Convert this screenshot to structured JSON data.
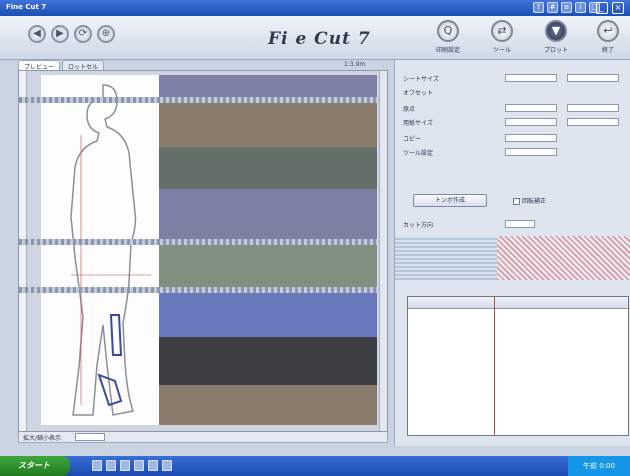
{
  "window": {
    "title": "Fine Cut 7",
    "logo_text": "Fi e Cut 7",
    "scale_text": "1:3.9m"
  },
  "toolbar": {
    "nav_buttons": [
      "◀",
      "▶",
      "⟳",
      "⊕"
    ],
    "buttons": [
      {
        "label": "印刷設定",
        "icon": "search-icon"
      },
      {
        "label": "ツール",
        "icon": "settings-icon"
      },
      {
        "label": "プロット",
        "icon": "plotter-icon"
      },
      {
        "label": "終了",
        "icon": "exit-icon"
      }
    ]
  },
  "tabs": [
    {
      "label": "プレビュー",
      "active": true
    },
    {
      "label": "ロットセル",
      "active": false
    }
  ],
  "canvas_bottom": {
    "zoom_label": "拡大/縮小表示"
  },
  "properties": {
    "row1_label": "シートサイズ",
    "row2_label": "オフセット",
    "row3_label": "原点",
    "row4_label": "用紙サイズ",
    "row5_label": "コピー",
    "row6_label": "ツール設定",
    "button_primary": "トンボ作成",
    "checkbox_label": "回転補正",
    "row7_label": "カット方向"
  },
  "taskbar": {
    "start_label": "スタート",
    "clock": "午前 0:00"
  },
  "colors": {
    "stripe_purple": "#7d7fa5",
    "stripe_brown": "#8b7d6e",
    "stripe_gray": "#66706a",
    "stripe_sage": "#7f9180",
    "stripe_blue": "#6879bd",
    "stripe_dark": "#3d3f45"
  }
}
